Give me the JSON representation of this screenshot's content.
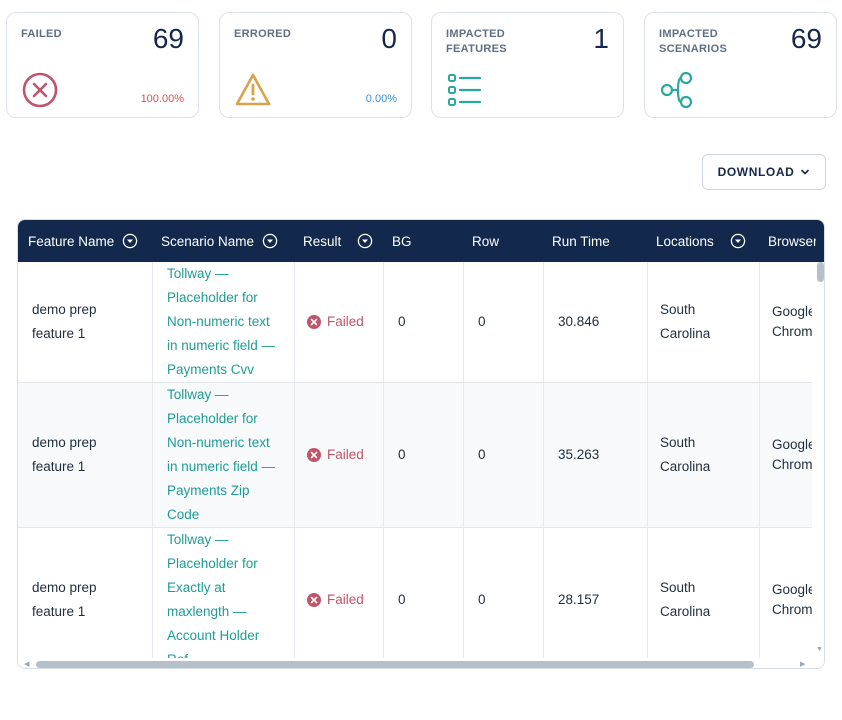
{
  "cards": [
    {
      "label": "FAILED",
      "value": "69",
      "pct": "100.00%",
      "pct_color": "#d9534f",
      "icon": "x-circle-icon",
      "color": "#c0546a"
    },
    {
      "label": "ERRORED",
      "value": "0",
      "pct": "0.00%",
      "pct_color": "#3a8fd6",
      "icon": "warning-icon",
      "color": "#d7a34a"
    },
    {
      "label": "IMPACTED FEATURES",
      "value": "1",
      "pct": "",
      "icon": "list-icon",
      "color": "#2aa8a0"
    },
    {
      "label": "IMPACTED SCENARIOS",
      "value": "69",
      "pct": "",
      "icon": "share-nodes-icon",
      "color": "#2aa8a0"
    }
  ],
  "toolbar": {
    "download_label": "DOWNLOAD"
  },
  "table": {
    "columns": [
      "Feature Name",
      "Scenario Name",
      "Result",
      "BG",
      "Row",
      "Run Time",
      "Locations",
      "Browser"
    ],
    "rows": [
      {
        "feature": [
          "demo prep",
          "feature 1"
        ],
        "scenario": [
          "Tollway —",
          "Placeholder for",
          "Non-numeric text",
          "in numeric field —",
          "Payments Cvv"
        ],
        "result": "Failed",
        "bg": "0",
        "row": "0",
        "runtime": "30.846",
        "location": [
          "South",
          "Carolina"
        ],
        "browser": [
          "Google",
          "Chrome"
        ]
      },
      {
        "feature": [
          "demo prep",
          "feature 1"
        ],
        "scenario": [
          "Tollway —",
          "Placeholder for",
          "Non-numeric text",
          "in numeric field —",
          "Payments Zip",
          "Code"
        ],
        "result": "Failed",
        "bg": "0",
        "row": "0",
        "runtime": "35.263",
        "location": [
          "South",
          "Carolina"
        ],
        "browser": [
          "Google",
          "Chrome"
        ]
      },
      {
        "feature": [
          "demo prep",
          "feature 1"
        ],
        "scenario": [
          "Tollway —",
          "Placeholder for",
          "Exactly at",
          "maxlength —",
          "Account Holder",
          "Ref..."
        ],
        "result": "Failed",
        "bg": "0",
        "row": "0",
        "runtime": "28.157",
        "location": [
          "South",
          "Carolina"
        ],
        "browser": [
          "Google",
          "Chrome"
        ]
      }
    ]
  }
}
